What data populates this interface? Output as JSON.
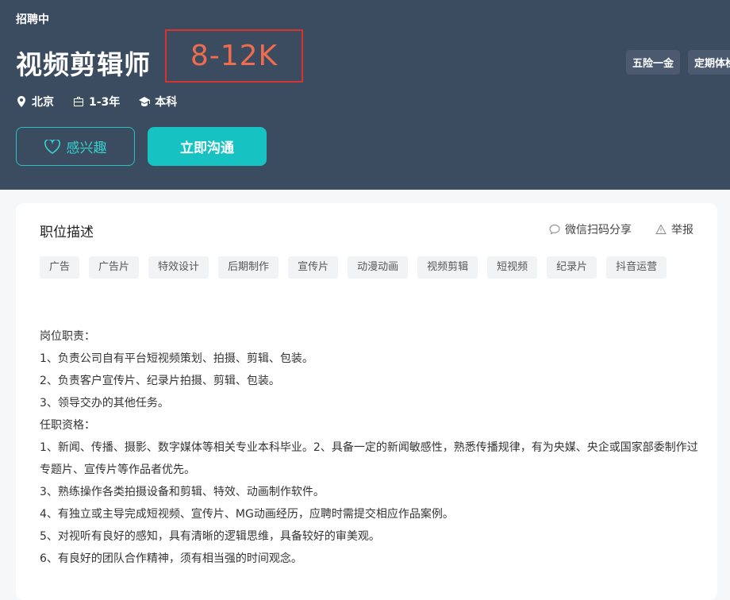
{
  "header": {
    "status": "招聘中",
    "title": "视频剪辑师",
    "salary": "8-12K",
    "meta": [
      {
        "icon": "location-pin-icon",
        "text": "北京"
      },
      {
        "icon": "briefcase-icon",
        "text": "1-3年"
      },
      {
        "icon": "graduation-cap-icon",
        "text": "本科"
      }
    ],
    "interest_label": "感兴趣",
    "chat_label": "立即沟通",
    "benefits": [
      "五险一金",
      "定期体检"
    ]
  },
  "card": {
    "title": "职位描述",
    "share_label": "微信扫码分享",
    "report_label": "举报",
    "tags": [
      "广告",
      "广告片",
      "特效设计",
      "后期制作",
      "宣传片",
      "动漫动画",
      "视频剪辑",
      "短视频",
      "纪录片",
      "抖音运营"
    ],
    "description": [
      "岗位职责：",
      "1、负责公司自有平台短视频策划、拍摄、剪辑、包装。",
      "2、负责客户宣传片、纪录片拍摄、剪辑、包装。",
      "3、领导交办的其他任务。",
      "任职资格：",
      "1、新闻、传播、摄影、数字媒体等相关专业本科毕业。2、具备一定的新闻敏感性，熟悉传播规律，有为央媒、央企或国家部委制作过专题片、宣传片等作品者优先。",
      "3、熟练操作各类拍摄设备和剪辑、特效、动画制作软件。",
      "4、有独立或主导完成短视频、宣传片、MG动画经历，应聘时需提交相应作品案例。",
      "5、对视听有良好的感知，具有清晰的逻辑思维，具备较好的审美观。",
      "6、有良好的团队合作精神，须有相当强的时间观念。"
    ]
  },
  "colors": {
    "header_bg": "#3b4b60",
    "accent": "#16c2c2",
    "salary": "#ef6c4f",
    "highlight_box": "#d8322f"
  }
}
